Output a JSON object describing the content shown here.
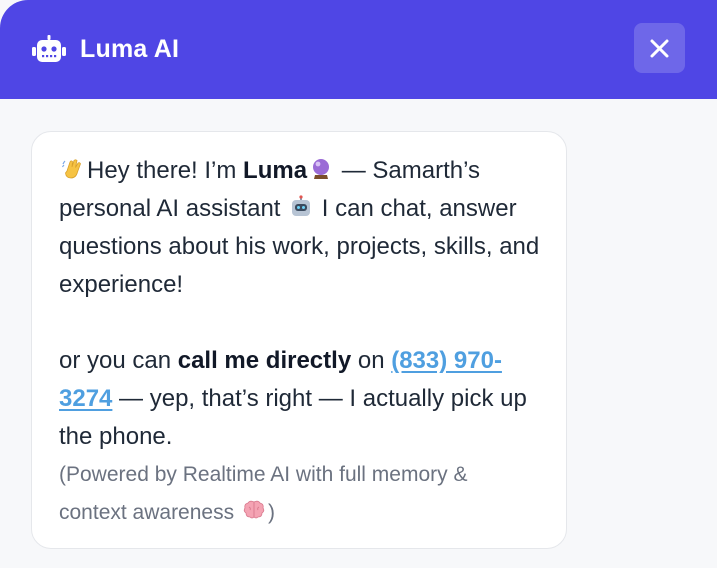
{
  "header": {
    "title": "Luma AI",
    "icon": "robot-icon",
    "accent": "#4f46e5"
  },
  "close": {
    "icon": "close-icon"
  },
  "message": {
    "wave_icon": "waving-hand-icon",
    "greeting": "Hey there! I’m ",
    "name": "Luma",
    "crystal_icon": "crystal-ball-icon",
    "intro_rest": " — Samarth’s personal AI assistant ",
    "robot_icon": "robot-face-icon",
    "intro_end": " I can chat, answer questions about his work, projects, skills, and experience!",
    "call_prefix": "or you can ",
    "call_bold": "call me directly",
    "call_on": " on ",
    "phone": "(833) 970-3274",
    "call_suffix": " — yep, that’s right — I actually pick up the phone.",
    "note_prefix": "(Powered by Realtime AI with full memory & context awareness ",
    "brain_icon": "brain-icon",
    "note_suffix": ")"
  }
}
